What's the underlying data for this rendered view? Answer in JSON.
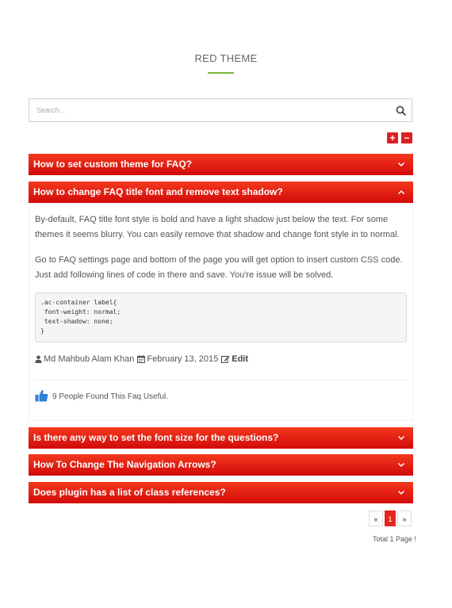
{
  "page": {
    "title": "RED THEME"
  },
  "search": {
    "placeholder": "Search..."
  },
  "controls": {
    "expand_all": "+",
    "collapse_all": "−"
  },
  "faqs": [
    {
      "question": "How to set custom theme for FAQ?",
      "expanded": false
    },
    {
      "question": "How to change FAQ title font and remove text shadow?",
      "expanded": true
    },
    {
      "question": "Is there any way to set the font size for the questions?",
      "expanded": false
    },
    {
      "question": "How To Change The Navigation Arrows?",
      "expanded": false
    },
    {
      "question": "Does plugin has a list of class references?",
      "expanded": false
    }
  ],
  "answer": {
    "paragraph1": "By-default, FAQ title font style is bold and have a light shadow just below the text. For some themes it seems blurry. You can easily remove that shadow and change font style in to normal.",
    "paragraph2": "Go to FAQ settings page and bottom of the page you will get option to insert custom CSS code. Just add following lines of code in there and save. You're issue will be solved.",
    "code": ".ac-container label{\n font-weight: normal;\n text-shadow: none;\n}",
    "author": "Md Mahbub Alam Khan",
    "date": "February 13, 2015",
    "edit_label": "Edit",
    "useful_text": "9 People Found This Faq Useful."
  },
  "pagination": {
    "prev": "«",
    "current": "1",
    "next": "»",
    "total": "Total 1 Page !"
  },
  "colors": {
    "accent_green": "#7cb342",
    "header_red": "#e02020",
    "thumb_blue": "#2f80d8"
  }
}
